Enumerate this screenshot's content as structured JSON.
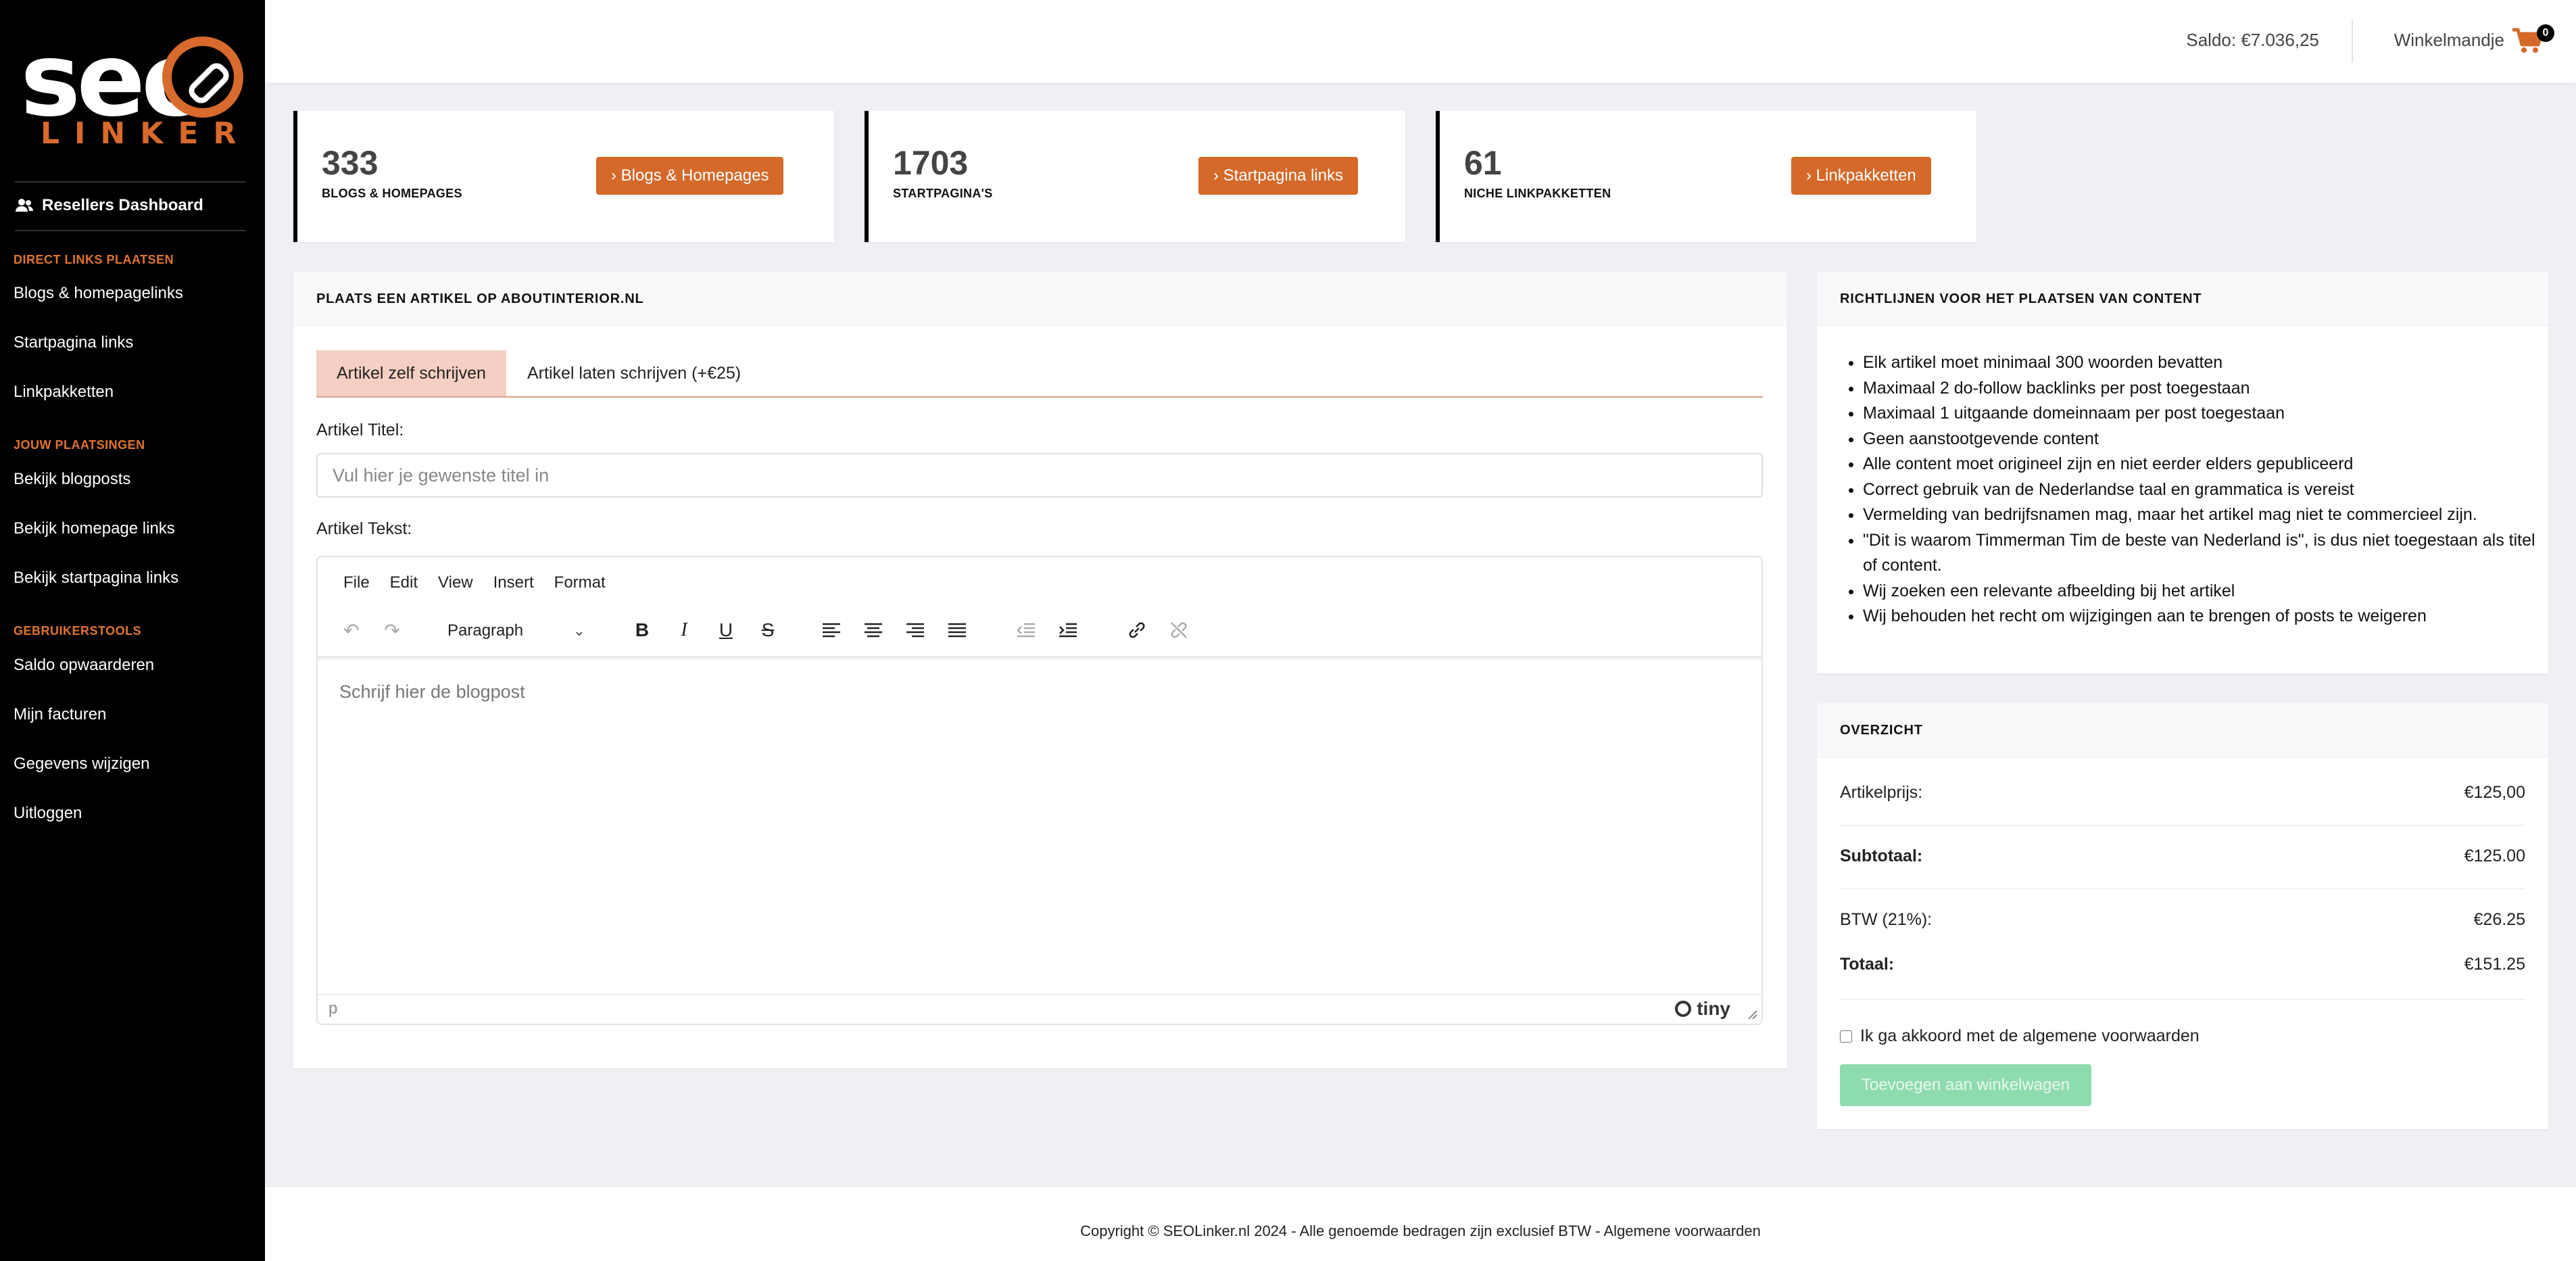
{
  "brand": {
    "logo_text": "seo",
    "logo_sub": "LINKER",
    "accent": "#d4692a"
  },
  "sidebar": {
    "dashboard": "Resellers Dashboard",
    "sections": [
      {
        "title": "DIRECT LINKS PLAATSEN",
        "items": [
          "Blogs & homepagelinks",
          "Startpagina links",
          "Linkpakketten"
        ]
      },
      {
        "title": "JOUW PLAATSINGEN",
        "items": [
          "Bekijk blogposts",
          "Bekijk homepage links",
          "Bekijk startpagina links"
        ]
      },
      {
        "title": "GEBRUIKERSTOOLS",
        "items": [
          "Saldo opwaarderen",
          "Mijn facturen",
          "Gegevens wijzigen",
          "Uitloggen"
        ]
      }
    ]
  },
  "topbar": {
    "saldo": "Saldo: €7.036,25",
    "cart_label": "Winkelmandje",
    "cart_count": "0"
  },
  "stats": [
    {
      "number": "333",
      "label": "BLOGS & HOMEPAGES",
      "button": "Blogs & Homepages"
    },
    {
      "number": "1703",
      "label": "STARTPAGINA'S",
      "button": "Startpagina links"
    },
    {
      "number": "61",
      "label": "NICHE LINKPAKKETTEN",
      "button": "Linkpakketten"
    }
  ],
  "article": {
    "heading": "PLAATS EEN ARTIKEL OP ABOUTINTERIOR.NL",
    "tabs": [
      "Artikel zelf schrijven",
      "Artikel laten schrijven (+€25)"
    ],
    "title_label": "Artikel Titel:",
    "title_placeholder": "Vul hier je gewenste titel in",
    "text_label": "Artikel Tekst:",
    "menu": [
      "File",
      "Edit",
      "View",
      "Insert",
      "Format"
    ],
    "block_format": "Paragraph",
    "editor_placeholder": "Schrijf hier de blogpost",
    "status_path": "p",
    "powered_by": "tiny"
  },
  "guidelines": {
    "heading": "RICHTLIJNEN VOOR HET PLAATSEN VAN CONTENT",
    "items": [
      "Elk artikel moet minimaal 300 woorden bevatten",
      "Maximaal 2 do-follow backlinks per post toegestaan",
      "Maximaal 1 uitgaande domeinnaam per post toegestaan",
      "Geen aanstootgevende content",
      "Alle content moet origineel zijn en niet eerder elders gepubliceerd",
      "Correct gebruik van de Nederlandse taal en grammatica is vereist",
      "Vermelding van bedrijfsnamen mag, maar het artikel mag niet te commercieel zijn.",
      "\"Dit is waarom Timmerman Tim de beste van Nederland is\", is dus niet toegestaan als titel of content.",
      "Wij zoeken een relevante afbeelding bij het artikel",
      "Wij behouden het recht om wijzigingen aan te brengen of posts te weigeren"
    ]
  },
  "overview": {
    "heading": "OVERZICHT",
    "price_label": "Artikelprijs:",
    "price": "€125,00",
    "subtotal_label": "Subtotaal:",
    "subtotal": "€125.00",
    "vat_label": "BTW (21%):",
    "vat": "€26.25",
    "total_label": "Totaal:",
    "total": "€151.25",
    "agree": "Ik ga akkoord met de algemene voorwaarden",
    "add_button": "Toevoegen aan winkelwagen"
  },
  "footer": "Copyright © SEOLinker.nl 2024 - Alle genoemde bedragen zijn exclusief BTW - Algemene voorwaarden"
}
